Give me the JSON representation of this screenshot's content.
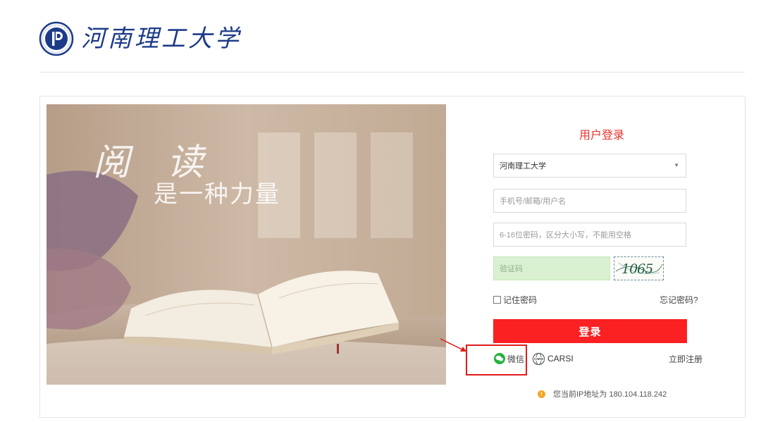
{
  "header": {
    "logo_text": "河南理工大学",
    "emblem_icon": "hpu-emblem-icon"
  },
  "banner": {
    "title": "阅 读",
    "subtitle": "是一种力量"
  },
  "login": {
    "title": "用户登录",
    "school_select": {
      "selected": "河南理工大学",
      "arrow_icon": "caret-down-icon"
    },
    "username_placeholder": "手机号/邮箱/用户名",
    "password_placeholder": "6-16位密码，区分大小写，不能用空格",
    "captcha_placeholder": "验证码",
    "captcha_text": "1065",
    "remember_label": "记住密码",
    "forgot_label": "忘记密码?",
    "submit_label": "登录",
    "wechat_label": "微信",
    "carsi_label": "CARSI",
    "register_label": "立即注册",
    "ip_notice": "您当前IP地址为 180.104.118.242"
  },
  "colors": {
    "accent": "#fb2021",
    "title_red": "#e8342e",
    "captcha_bg": "#d9f1d1",
    "wechat_green": "#22b33b",
    "annotation_red": "#e21c1c"
  }
}
